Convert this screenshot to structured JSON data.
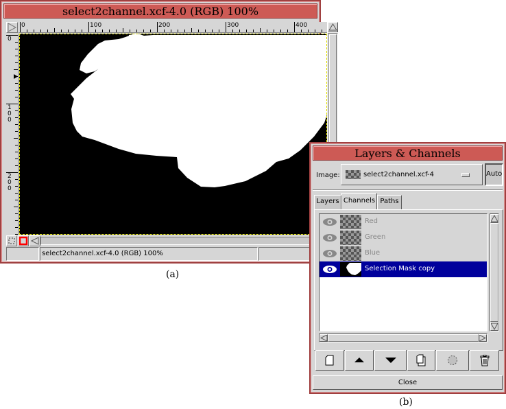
{
  "image_window": {
    "title": "select2channel.xcf-4.0 (RGB) 100%",
    "hruler_labels": [
      "0",
      "100",
      "200",
      "300",
      "400"
    ],
    "vruler_labels": [
      "0",
      "100",
      "200"
    ],
    "status_text": "select2channel.xcf-4.0 (RGB) 100%",
    "caption": "(a)"
  },
  "layers_window": {
    "title": "Layers & Channels",
    "image_label": "Image:",
    "image_selected": "select2channel.xcf-4",
    "auto_label": "Auto",
    "tabs": [
      {
        "label": "Layers",
        "active": false
      },
      {
        "label": "Channels",
        "active": true
      },
      {
        "label": "Paths",
        "active": false
      }
    ],
    "channels": [
      {
        "name": "Red",
        "selected": false,
        "thumbnail": "checker"
      },
      {
        "name": "Green",
        "selected": false,
        "thumbnail": "checker"
      },
      {
        "name": "Blue",
        "selected": false,
        "thumbnail": "checker"
      },
      {
        "name": "Selection Mask copy",
        "selected": true,
        "thumbnail": "mask"
      }
    ],
    "toolbar": [
      {
        "icon": "new-channel-icon"
      },
      {
        "icon": "raise-channel-icon"
      },
      {
        "icon": "lower-channel-icon"
      },
      {
        "icon": "duplicate-channel-icon"
      },
      {
        "icon": "channel-to-selection-icon"
      },
      {
        "icon": "delete-channel-icon"
      }
    ],
    "close_label": "Close",
    "caption": "(b)"
  },
  "colors": {
    "titlebar": "#cd5a55",
    "selection_row": "#00009c",
    "marching_ants": "#e0e000",
    "qmask_indicator": "#ff0000"
  }
}
